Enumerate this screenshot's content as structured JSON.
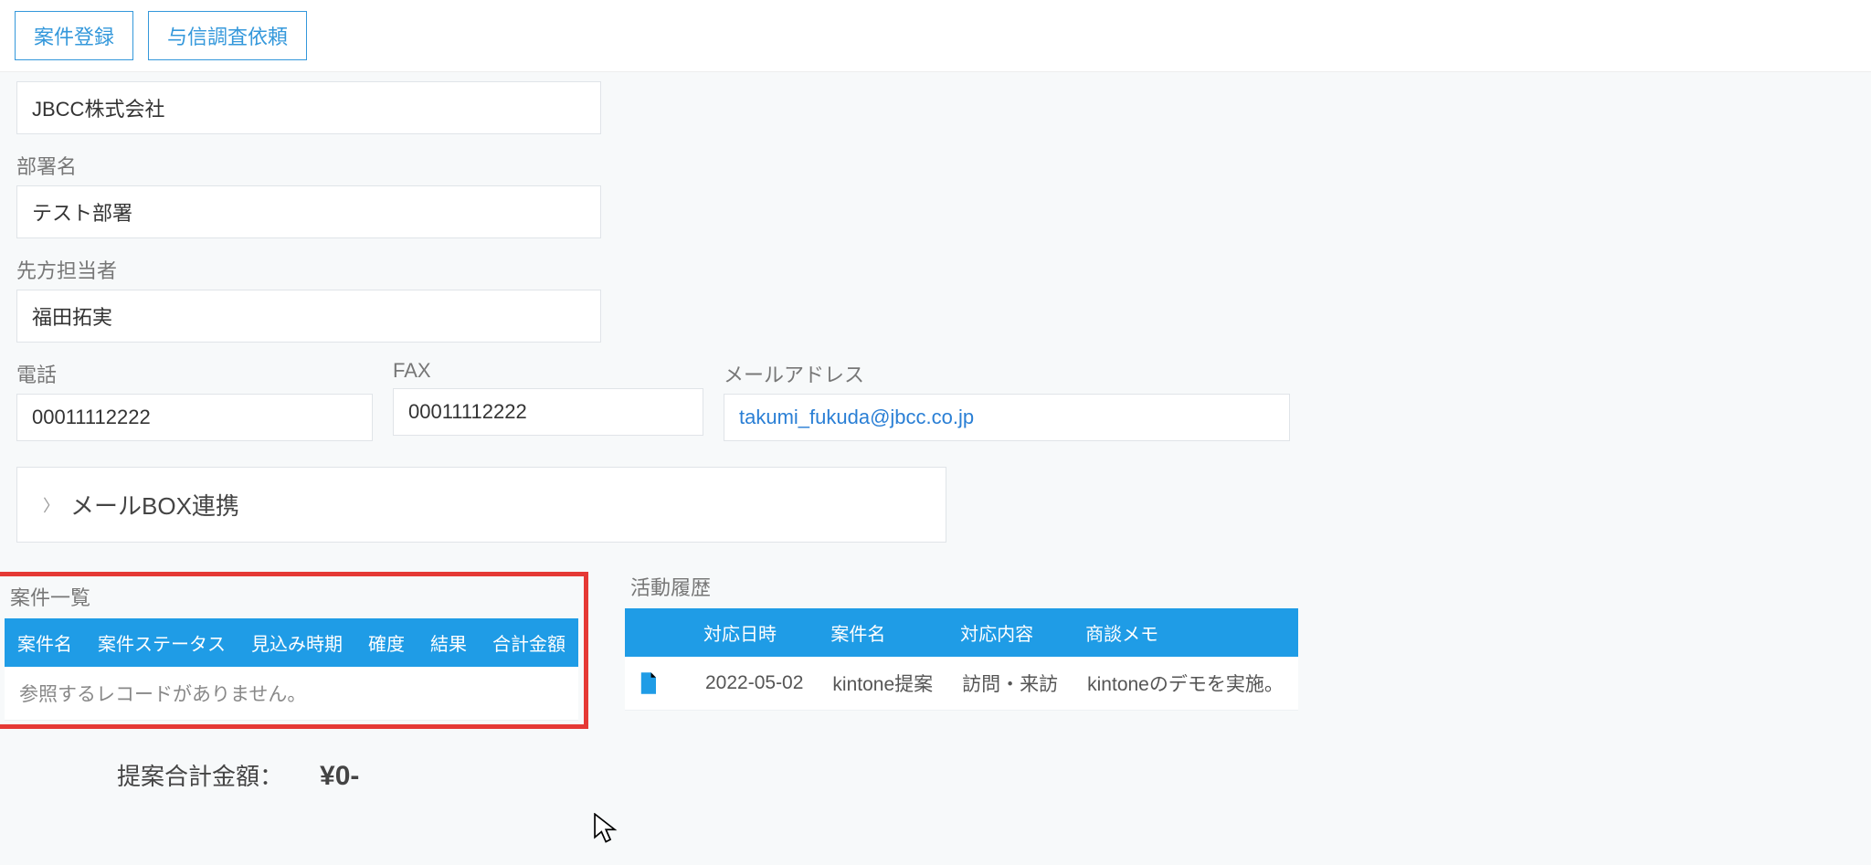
{
  "toolbar": {
    "btn_register": "案件登録",
    "btn_credit": "与信調査依頼"
  },
  "fields": {
    "company_value": "JBCC株式会社",
    "dept_label": "部署名",
    "dept_value": "テスト部署",
    "contact_label": "先方担当者",
    "contact_value": "福田拓実",
    "tel_label": "電話",
    "tel_value": "00011112222",
    "fax_label": "FAX",
    "fax_value": "00011112222",
    "email_label": "メールアドレス",
    "email_value": "takumi_fukuda@jbcc.co.jp"
  },
  "expander": {
    "title": "メールBOX連携"
  },
  "deal_list": {
    "title": "案件一覧",
    "headers": [
      "案件名",
      "案件ステータス",
      "見込み時期",
      "確度",
      "結果",
      "合計金額"
    ],
    "empty_msg": "参照するレコードがありません。"
  },
  "activity": {
    "title": "活動履歴",
    "headers": [
      "",
      "対応日時",
      "案件名",
      "対応内容",
      "商談メモ"
    ],
    "rows": [
      {
        "date": "2022-05-02",
        "deal": "kintone提案",
        "action": "訪問・来訪",
        "memo": "kintoneのデモを実施。"
      }
    ]
  },
  "summary": {
    "label": "提案合計金額：",
    "value": "¥0-"
  }
}
